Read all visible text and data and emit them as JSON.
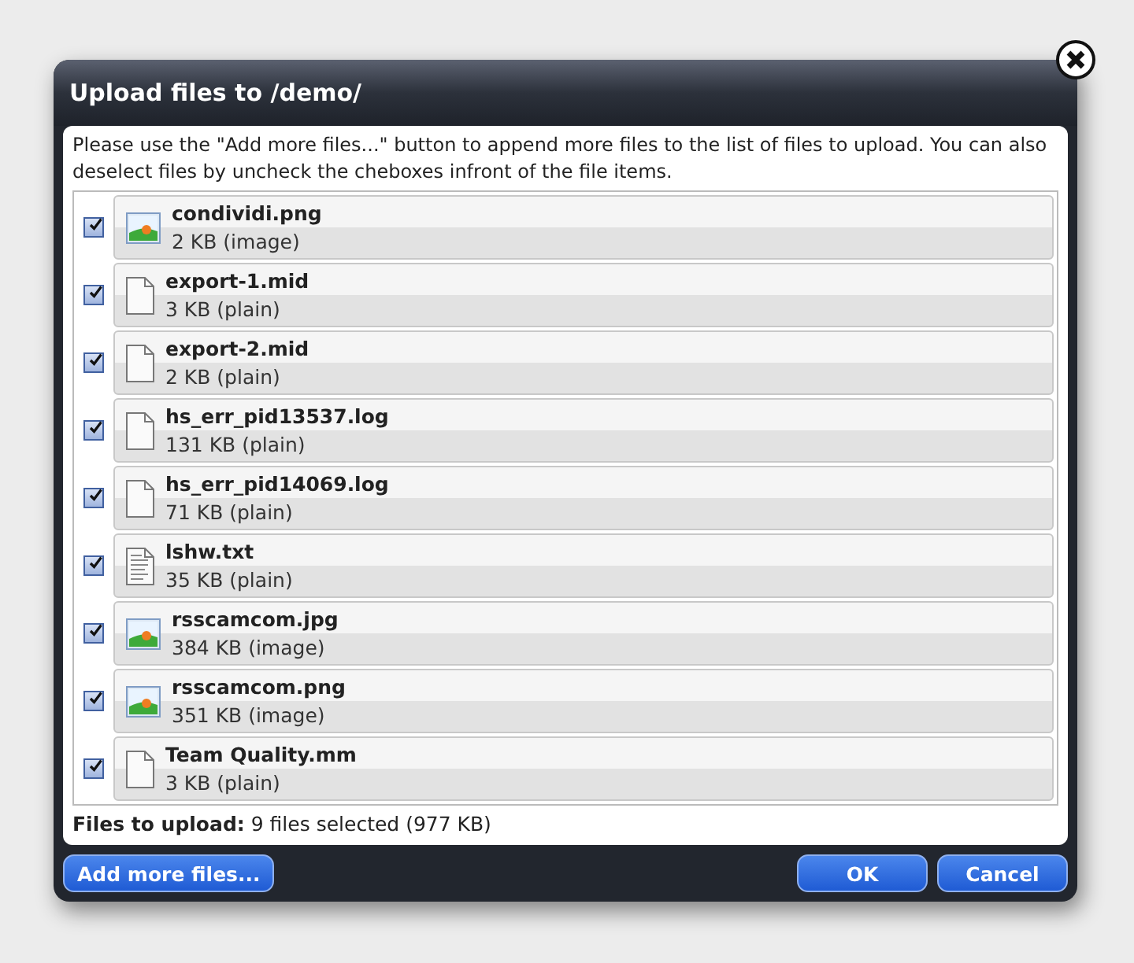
{
  "dialog": {
    "title": "Upload files to /demo/",
    "intro": "Please use the \"Add more files...\" button to append more files to the list of files to upload. You can also deselect files by uncheck the cheboxes infront of the file items.",
    "files": [
      {
        "name": "condividi.png",
        "size": "2 KB (image)",
        "kind": "image",
        "checked": true
      },
      {
        "name": "export-1.mid",
        "size": "3 KB (plain)",
        "kind": "plain",
        "checked": true
      },
      {
        "name": "export-2.mid",
        "size": "2 KB (plain)",
        "kind": "plain",
        "checked": true
      },
      {
        "name": "hs_err_pid13537.log",
        "size": "131 KB (plain)",
        "kind": "plain",
        "checked": true
      },
      {
        "name": "hs_err_pid14069.log",
        "size": "71 KB (plain)",
        "kind": "plain",
        "checked": true
      },
      {
        "name": "lshw.txt",
        "size": "35 KB (plain)",
        "kind": "text",
        "checked": true
      },
      {
        "name": "rsscamcom.jpg",
        "size": "384 KB (image)",
        "kind": "image",
        "checked": true
      },
      {
        "name": "rsscamcom.png",
        "size": "351 KB (image)",
        "kind": "image",
        "checked": true
      },
      {
        "name": "Team Quality.mm",
        "size": "3 KB (plain)",
        "kind": "plain",
        "checked": true
      }
    ],
    "summary": "**Files to upload:** 9 files selected (977 KB)",
    "buttons": {
      "add": "Add more files...",
      "ok": "OK",
      "cancel": "Cancel"
    }
  }
}
